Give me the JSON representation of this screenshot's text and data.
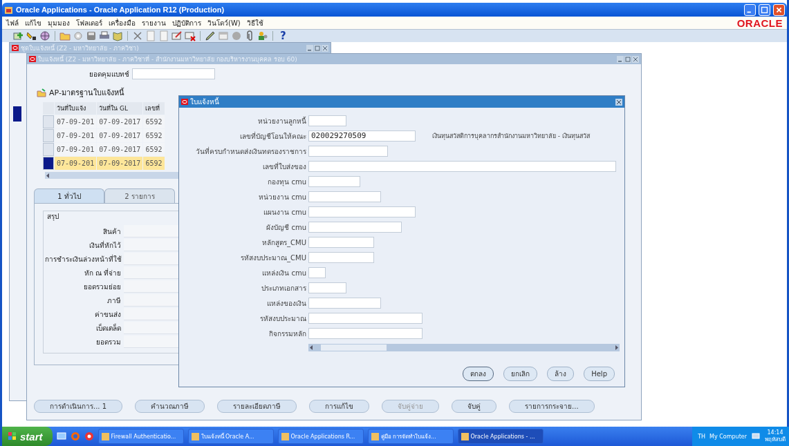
{
  "window": {
    "title": "Oracle Applications - Oracle Application R12 (Production)"
  },
  "menu": [
    "ไฟล์",
    "แก้ไข",
    "มุมมอง",
    "โฟลเดอร์",
    "เครื่องมือ",
    "รายงาน",
    "ปฏิบัติการ",
    "วินโดว์(W)",
    "วิธีใช้"
  ],
  "logo": "ORACLE",
  "toolbar": {
    "help": "?"
  },
  "batch_window": {
    "title": "ชุดใบแจ้งหนี้ (Z2 - มหาวิทยาลัย - ภาควิชา)"
  },
  "invoice_window": {
    "title": "ใบแจ้งหนี้ (Z2 - มหาวิทยาลัย - ภาควิชาที่ - สำนักงานมหาวิทยาลัย กองบริหารงานบุคคล รอบ 60)",
    "batch_control_label": "ยอดคุมแบทช์",
    "folder": "AP-มาตรฐานใบแจ้งหนี้",
    "table": {
      "columns": [
        "วันที่ใบแจ้ง",
        "วันที่ใน GL",
        "เลขที่"
      ],
      "rows": [
        {
          "cells": [
            "07-09-201",
            "07-09-2017",
            "6592"
          ],
          "selected": false
        },
        {
          "cells": [
            "07-09-201",
            "07-09-2017",
            "6592"
          ],
          "selected": false
        },
        {
          "cells": [
            "07-09-201",
            "07-09-2017",
            "6592"
          ],
          "selected": false
        },
        {
          "cells": [
            "07-09-201",
            "07-09-2017",
            "6592"
          ],
          "selected": true
        }
      ]
    },
    "tabs": [
      {
        "label": "1 ทั่วไป",
        "selected": true
      },
      {
        "label": "2 รายการ",
        "selected": false
      }
    ],
    "summary": {
      "title": "สรุป",
      "labels": [
        "สินค้า",
        "เงินที่หักไว้",
        "การชำระเงินล่วงหน้าที่ใช้",
        "หัก ณ ที่จ่าย",
        "ยอดรวมย่อย",
        "ภาษี",
        "ค่าขนส่ง",
        "เบ็ดเตล็ด",
        "ยอดรวม"
      ]
    },
    "buttons": [
      {
        "label": "การดำเนินการ... 1",
        "disabled": false
      },
      {
        "label": "คำนวณภาษี",
        "disabled": false
      },
      {
        "label": "รายละเอียดภาษี",
        "disabled": false
      },
      {
        "label": "การแก้ไข",
        "disabled": false
      },
      {
        "label": "จับคู่จ่าย",
        "disabled": true
      },
      {
        "label": "จับคู่",
        "disabled": false
      },
      {
        "label": "รายการกระจาย...",
        "disabled": false
      }
    ]
  },
  "dialog": {
    "title": "ใบแจ้งหนี้",
    "fields": [
      {
        "label": "หน่วยงานลูกหนี้"
      },
      {
        "label": "เลขที่บัญชีโอนให้คณะ",
        "value": "020029270509",
        "description": "เงินทุนสวัสดิการบุคลากรสำนักงานมหาวิทยาลัย - เงินทุนสวัส"
      },
      {
        "label": "วันที่ครบกำหนดส่งเงินทดรองราชการ"
      },
      {
        "label": "เลขที่ใบส่งของ"
      },
      {
        "label": "กองทุน cmu"
      },
      {
        "label": "หน่วยงาน cmu"
      },
      {
        "label": "แผนงาน cmu"
      },
      {
        "label": "ผังบัญชี cmu"
      },
      {
        "label": "หลักสูตร_CMU"
      },
      {
        "label": "รหัสงบประมาณ_CMU"
      },
      {
        "label": "แหล่งเงิน cmu"
      },
      {
        "label": "ประเภทเอกสาร"
      },
      {
        "label": "แหล่งของเงิน"
      },
      {
        "label": "รหัสงบประมาณ"
      },
      {
        "label": "กิจกรรมหลัก"
      }
    ],
    "buttons": [
      "ตกลง",
      "ยกเลิก",
      "ล้าง",
      "Help"
    ]
  },
  "taskbar": {
    "start": "start",
    "tasks": [
      {
        "label": "Firewall Authenticatio...",
        "selected": false
      },
      {
        "label": "ใบแจ้งหนี้ Oracle A...",
        "selected": false
      },
      {
        "label": "Oracle Applications R...",
        "selected": false
      },
      {
        "label": "คู่มือ การจัดทำใบแจ้ง...",
        "selected": false
      },
      {
        "label": "Oracle Applications - ...",
        "selected": true
      }
    ],
    "language": "TH",
    "location": "My Computer",
    "time": "14:14",
    "day": "พฤหัสบดี"
  }
}
